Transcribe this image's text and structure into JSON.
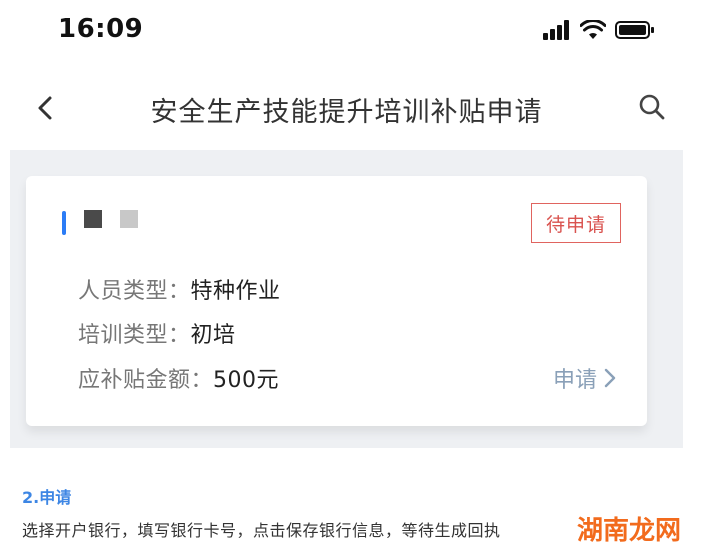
{
  "status_bar": {
    "time": "16:09",
    "icons": [
      "signal-icon",
      "wifi-icon",
      "battery-icon"
    ]
  },
  "nav": {
    "title": "安全生产技能提升培训补贴申请",
    "back_icon": "chevron-left-icon",
    "search_icon": "search-icon"
  },
  "card": {
    "status_badge": "待申请",
    "rows": [
      {
        "label": "人员类型：",
        "value": "特种作业"
      },
      {
        "label": "培训类型：",
        "value": "初培"
      },
      {
        "label": "应补贴金额：",
        "value": "500元"
      }
    ],
    "apply_label": "申请",
    "apply_icon": "chevron-right-icon"
  },
  "section": {
    "title": "2.申请",
    "description": "选择开户银行，填写银行卡号，点击保存银行信息，等待生成回执"
  },
  "watermark": "湖南龙网",
  "colors": {
    "accent": "#2b7cf6",
    "badge": "#d9534f",
    "section_title": "#3d86e4",
    "watermark": "#f26b1d"
  }
}
